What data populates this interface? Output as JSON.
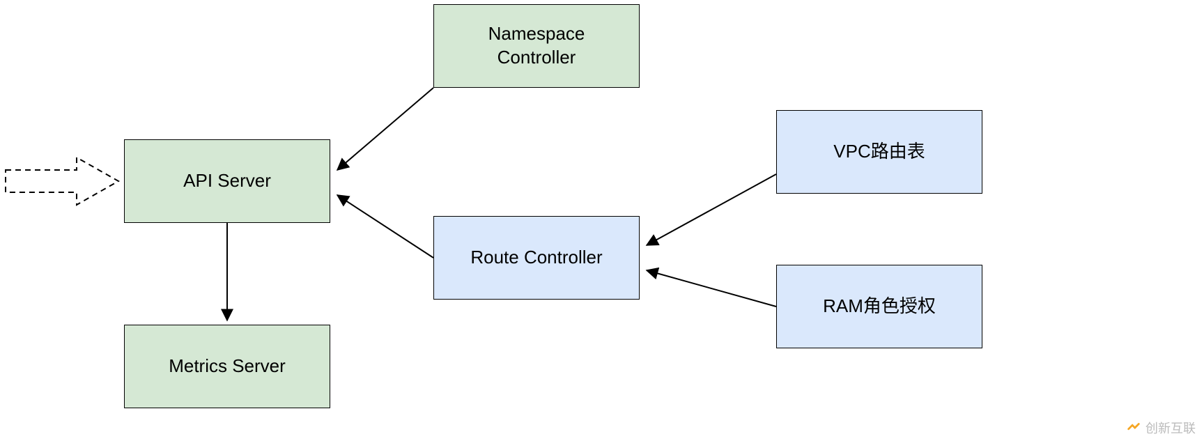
{
  "nodes": {
    "api_server": {
      "label": "API Server"
    },
    "metrics_server": {
      "label": "Metrics Server"
    },
    "namespace_controller": {
      "label": "Namespace\nController"
    },
    "route_controller": {
      "label": "Route Controller"
    },
    "vpc_route_table": {
      "label": "VPC路由表"
    },
    "ram_role_auth": {
      "label": "RAM角色授权"
    }
  },
  "edges": [
    {
      "from": "input-arrow",
      "to": "api_server"
    },
    {
      "from": "api_server",
      "to": "metrics_server"
    },
    {
      "from": "namespace_controller",
      "to": "api_server"
    },
    {
      "from": "route_controller",
      "to": "api_server"
    },
    {
      "from": "vpc_route_table",
      "to": "route_controller"
    },
    {
      "from": "ram_role_auth",
      "to": "route_controller"
    }
  ],
  "watermark": {
    "text": "创新互联"
  }
}
